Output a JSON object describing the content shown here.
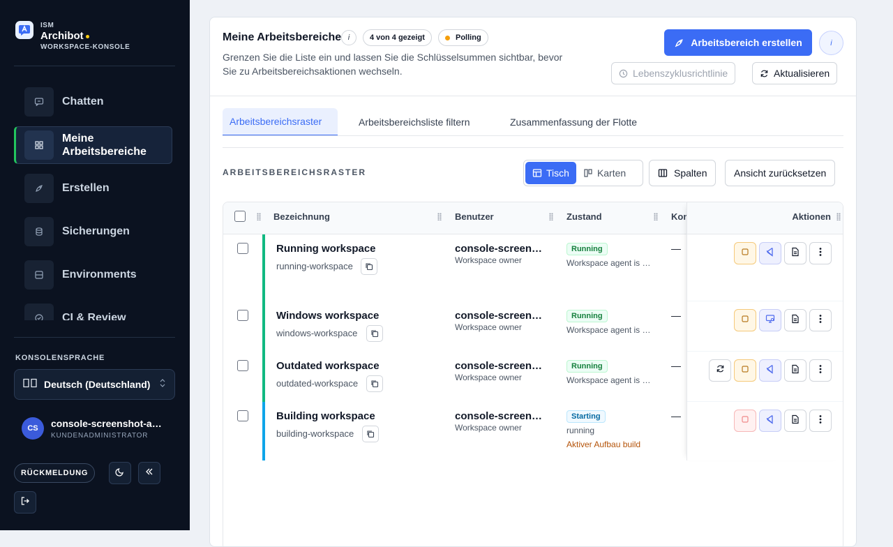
{
  "brand": {
    "tag": "ISM",
    "name": "Archibot",
    "subtitle": "WORKSPACE-KONSOLE"
  },
  "sidebar": {
    "items": [
      {
        "label": "Chatten",
        "icon": "chat-icon"
      },
      {
        "label": "Meine Arbeitsbereiche",
        "icon": "grid-icon"
      },
      {
        "label": "Erstellen",
        "icon": "rocket-icon"
      },
      {
        "label": "Sicherungen",
        "icon": "database-icon"
      },
      {
        "label": "Environments",
        "icon": "server-icon"
      },
      {
        "label": "CI & Review",
        "icon": "check-circle-icon"
      }
    ],
    "language_label": "KONSOLENSPRACHE",
    "language_value": "Deutsch (Deutschland)",
    "user": {
      "initials": "CS",
      "name": "console-screenshot-admin",
      "role": "KUNDENADMINISTRATOR"
    },
    "feedback_label": "RÜCKMELDUNG"
  },
  "header": {
    "title": "Meine Arbeitsbereiche",
    "count_badge": "4 von 4 gezeigt",
    "polling_badge": "Polling",
    "description": "Grenzen Sie die Liste ein und lassen Sie die Schlüsselsummen sichtbar, bevor Sie zu Arbeitsbereichsaktionen wechseln.",
    "create_button": "Arbeitsbereich erstellen",
    "lifecycle_button": "Lebenszyklusrichtlinie",
    "refresh_button": "Aktualisieren"
  },
  "tabs": [
    "Arbeitsbereichsraster",
    "Arbeitsbereichsliste filtern",
    "Zusammenfassung der Flotte"
  ],
  "grid": {
    "label": "ARBEITSBEREICHSRASTER",
    "view_table": "Tisch",
    "view_cards": "Karten",
    "columns_button": "Spalten",
    "reset_button": "Ansicht zurücksetzen"
  },
  "table": {
    "columns": [
      "Bezeichnung",
      "Benutzer",
      "Zustand",
      "Kon",
      "Aktionen"
    ],
    "rows": [
      {
        "name": "Running workspace",
        "slug": "running-workspace",
        "user": "console-screenshot-admin",
        "user_role": "Workspace owner",
        "status": "Running",
        "detail": "Workspace agent is connected",
        "extra": "",
        "kon": "—",
        "bar_color": "#10b981"
      },
      {
        "name": "Windows workspace",
        "slug": "windows-workspace",
        "user": "console-screenshot-admin",
        "user_role": "Workspace owner",
        "status": "Running",
        "detail": "Workspace agent is connected",
        "extra": "",
        "kon": "—",
        "bar_color": "#10b981"
      },
      {
        "name": "Outdated workspace",
        "slug": "outdated-workspace",
        "user": "console-screenshot-admin",
        "user_role": "Workspace owner",
        "status": "Running",
        "detail": "Workspace agent is connected",
        "extra": "",
        "kon": "—",
        "bar_color": "#10b981"
      },
      {
        "name": "Building workspace",
        "slug": "building-workspace",
        "user": "console-screenshot-admin",
        "user_role": "Workspace owner",
        "status": "Starting",
        "detail": "running",
        "extra": "Aktiver Aufbau build",
        "kon": "—",
        "bar_color": "#0ea5e9"
      }
    ]
  },
  "colors": {
    "accent": "#3b6cf5",
    "sidebar_bg": "#0b1220",
    "running": "#10b981",
    "starting": "#0ea5e9",
    "polling_dot": "#f59e0b"
  }
}
